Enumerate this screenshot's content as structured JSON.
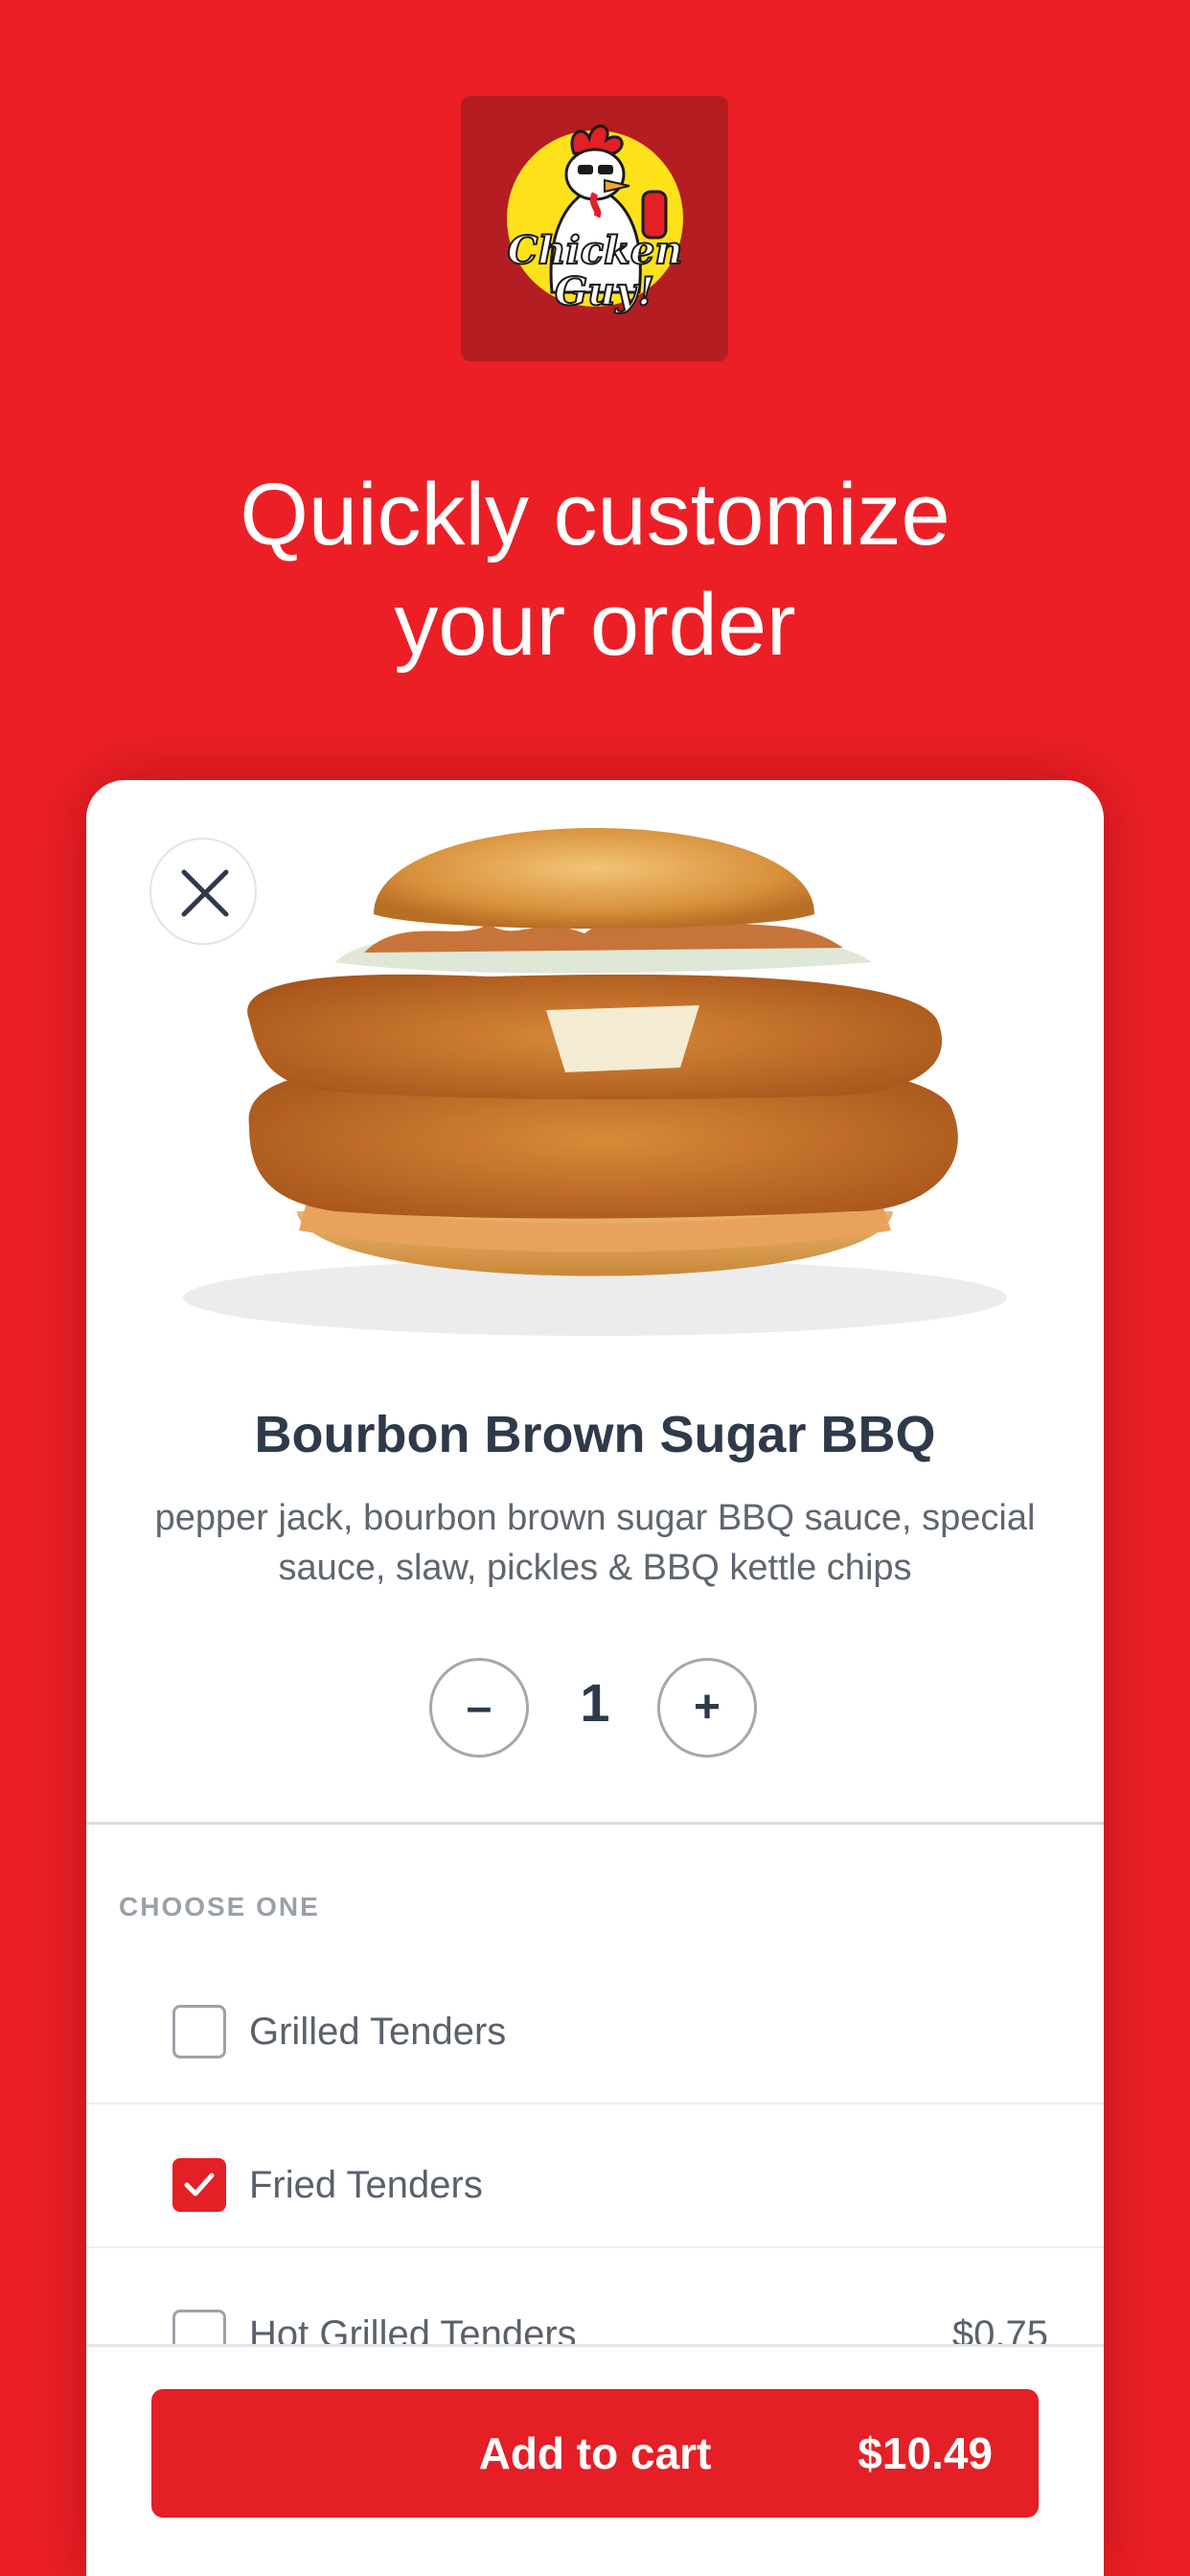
{
  "brand": {
    "logo_text_line1": "Chicken",
    "logo_text_line2": "Guy!",
    "logo_icon": "chicken-mascot-logo",
    "brand_color": "#ec1f26"
  },
  "headline": {
    "line1": "Quickly customize",
    "line2": "your order"
  },
  "product": {
    "name": "Bourbon Brown Sugar BBQ",
    "description": "pepper jack, bourbon brown sugar BBQ sauce, special sauce, slaw, pickles & BBQ kettle chips",
    "image_icon": "chicken-sandwich-image",
    "close_icon": "close-icon"
  },
  "quantity": {
    "minus_label": "–",
    "value": "1",
    "plus_label": "+"
  },
  "options": {
    "section_label": "CHOOSE ONE",
    "items": [
      {
        "label": "Grilled Tenders",
        "price": "",
        "checked": false
      },
      {
        "label": "Fried Tenders",
        "price": "",
        "checked": true
      },
      {
        "label": "Hot Grilled Tenders",
        "price": "$0.75",
        "checked": false
      }
    ]
  },
  "cart": {
    "button_label": "Add to cart",
    "price": "$10.49"
  }
}
